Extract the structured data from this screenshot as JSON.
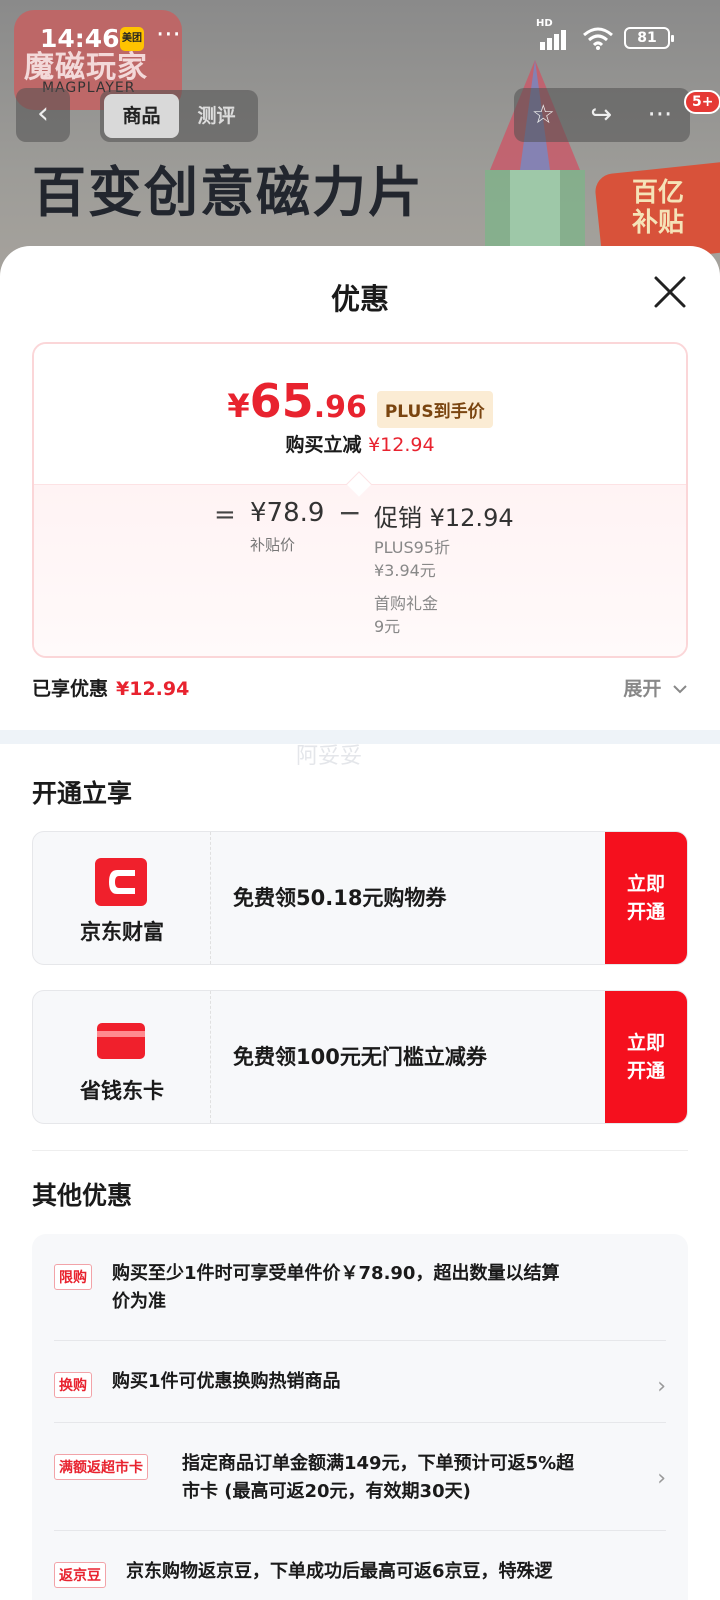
{
  "status_bar": {
    "time": "14:46",
    "app_badge": "美团",
    "more": "···",
    "network": "HD",
    "battery": "81"
  },
  "background": {
    "brand": "魔磁玩家",
    "brand_sub": "MAGPLAYER",
    "title": "百变创意磁力片",
    "badge_line1": "百亿",
    "badge_line2": "补贴"
  },
  "nav": {
    "back": "‹",
    "tabs": [
      "商品",
      "测评"
    ],
    "active_tab": 0,
    "star": "☆",
    "share": "↪",
    "more": "···",
    "badge": "5+"
  },
  "sheet": {
    "title": "优惠",
    "price": {
      "yen": "¥",
      "int": "65",
      "dec": ".96",
      "plus_tag": "PLUS到手价"
    },
    "reduce": {
      "label": "购买立减",
      "amount": "¥12.94"
    },
    "formula": {
      "eq": "=",
      "base_price": "¥78.9",
      "base_label": "补贴价",
      "minus": "−",
      "promo_title": "促销 ¥12.94",
      "promo_lines": [
        "PLUS95折",
        "¥3.94元",
        "首购礼金",
        "9元"
      ]
    },
    "enjoyed": {
      "label": "已享优惠",
      "amount": "¥12.94"
    },
    "expand": "展开",
    "watermark": "阿妥妥"
  },
  "open_section": {
    "title": "开通立享",
    "cards": [
      {
        "name": "京东财富",
        "text": "免费领50.18元购物券",
        "button": "立即\n开通"
      },
      {
        "name": "省钱东卡",
        "text": "免费领100元无门槛立减券",
        "button": "立即\n开通"
      }
    ]
  },
  "other_section": {
    "title": "其他优惠",
    "items": [
      {
        "tag": "限购",
        "line1": "购买至少1件时可享受单件价￥78.90，超出数量以结算",
        "line2": "价为准",
        "arrow": ""
      },
      {
        "tag": "换购",
        "line1": "购买1件可优惠换购热销商品",
        "line2": "",
        "arrow": "›"
      },
      {
        "tag": "满额返超市卡",
        "line1": "指定商品订单金额满149元，下单预计可返5%超",
        "line2": "市卡 (最高可返20元，有效期30天)",
        "arrow": "›"
      },
      {
        "tag": "返京豆",
        "line1": "京东购物返京豆，下单成功后最高可返6京豆，特殊逻",
        "line2": "",
        "arrow": ""
      }
    ]
  },
  "colors": {
    "accent_red": "#e8232f",
    "button_red": "#f5101e",
    "plus_bg": "#fbecd4"
  }
}
